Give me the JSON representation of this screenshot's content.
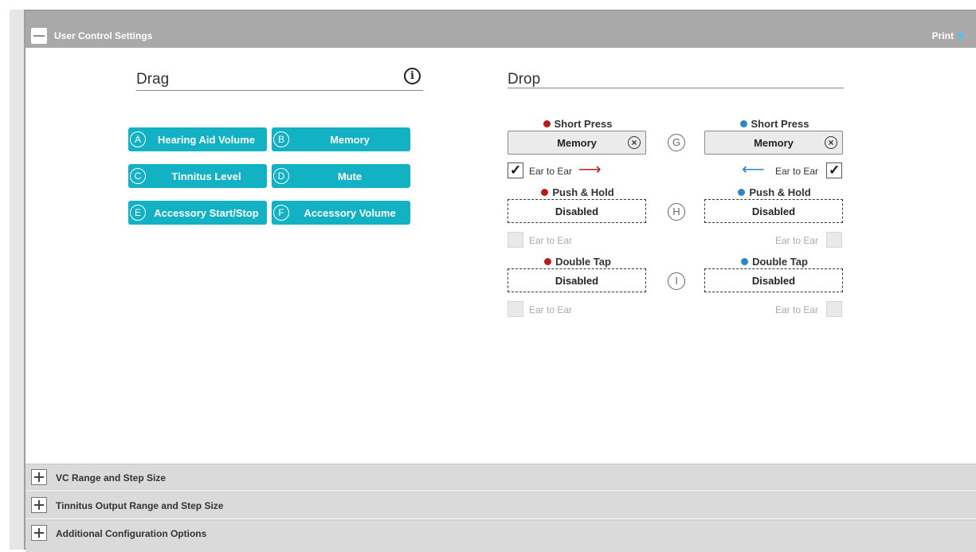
{
  "header": {
    "title": "User Control Settings",
    "print_label": "Print"
  },
  "drag": {
    "title": "Drag",
    "chips": [
      {
        "letter": "A",
        "label": "Hearing Aid Volume"
      },
      {
        "letter": "B",
        "label": "Memory"
      },
      {
        "letter": "C",
        "label": "Tinnitus Level"
      },
      {
        "letter": "D",
        "label": "Mute"
      },
      {
        "letter": "E",
        "label": "Accessory Start/Stop"
      },
      {
        "letter": "F",
        "label": "Accessory Volume"
      }
    ]
  },
  "drop": {
    "title": "Drop",
    "rows": [
      {
        "label": "Short Press",
        "letter": "G",
        "left_value": "Memory",
        "right_value": "Memory",
        "left_ear_to_ear": "Ear to Ear",
        "right_ear_to_ear": "Ear to Ear",
        "left_checked": true,
        "right_checked": true
      },
      {
        "label": "Push & Hold",
        "letter": "H",
        "left_value": "Disabled",
        "right_value": "Disabled",
        "left_ear_to_ear": "Ear to Ear",
        "right_ear_to_ear": "Ear to Ear",
        "left_checked": false,
        "right_checked": false
      },
      {
        "label": "Double Tap",
        "letter": "I",
        "left_value": "Disabled",
        "right_value": "Disabled",
        "left_ear_to_ear": "Ear to Ear",
        "right_ear_to_ear": "Ear to Ear",
        "left_checked": false,
        "right_checked": false
      }
    ]
  },
  "accordions": [
    {
      "title": "VC Range and Step Size"
    },
    {
      "title": "Tinnitus Output Range and Step Size"
    },
    {
      "title": "Additional Configuration Options"
    }
  ],
  "colors": {
    "chip": "#12b1c4",
    "left_side": "#b71c1c",
    "right_side": "#2e86c8",
    "header": "#a9a9a9"
  },
  "icons": {
    "info": "info-circle-icon",
    "clear": "clear-circle-x-icon",
    "print": "play-triangle-icon",
    "collapse": "minus-icon",
    "expand": "plus-icon"
  }
}
